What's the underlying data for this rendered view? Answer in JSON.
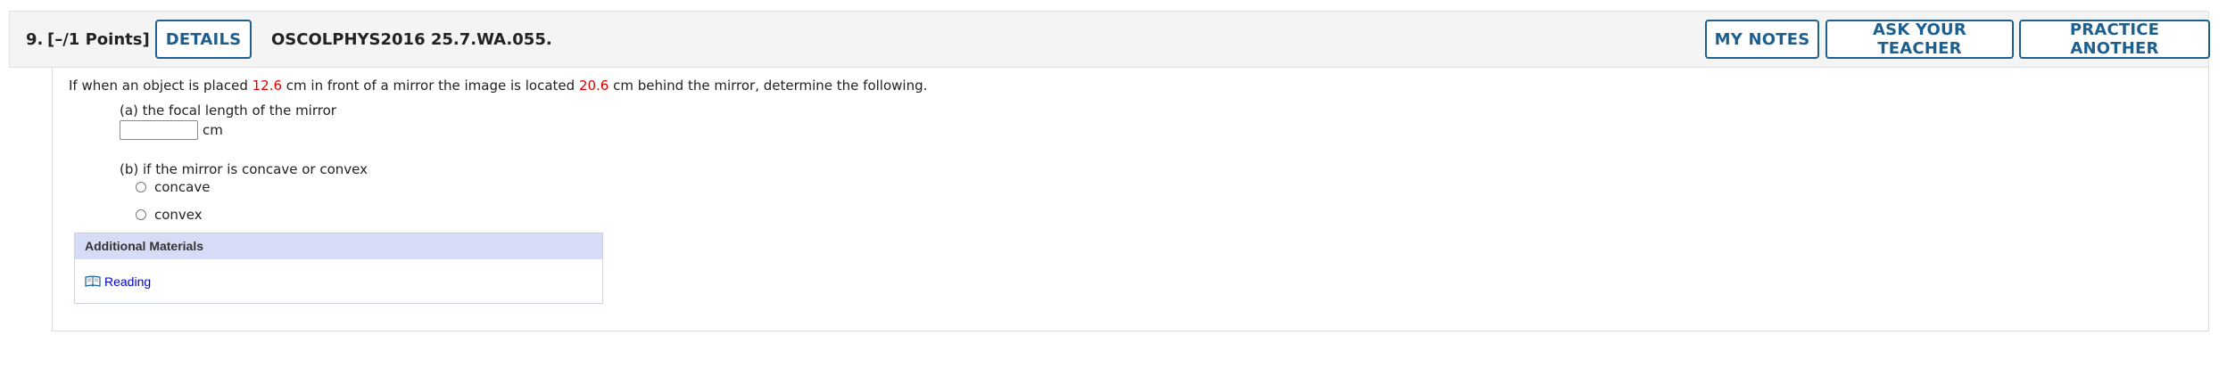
{
  "question": {
    "number": "9.",
    "points": "[–/1 Points]",
    "code": "OSCOLPHYS2016 25.7.WA.055."
  },
  "header_buttons": {
    "details": "DETAILS",
    "my_notes": "MY NOTES",
    "ask_teacher": "ASK YOUR TEACHER",
    "practice": "PRACTICE ANOTHER"
  },
  "prompt": {
    "part1": "If when an object is placed ",
    "object_distance": "12.6",
    "part2": " cm in front of a mirror the image is located ",
    "image_distance": "20.6",
    "part3": " cm behind the mirror, determine the following."
  },
  "part_a": {
    "label": "(a) the focal length of the mirror",
    "input_value": "",
    "unit": "cm"
  },
  "part_b": {
    "label": "(b) if the mirror is concave or convex",
    "options": [
      "concave",
      "convex"
    ]
  },
  "materials": {
    "header": "Additional Materials",
    "link_label": "Reading",
    "link_icon": "book-icon"
  },
  "colors": {
    "accent": "#1d5f8f",
    "value_highlight": "#e00000",
    "link": "#0000cc",
    "materials_header_bg": "#d6dcf5"
  }
}
